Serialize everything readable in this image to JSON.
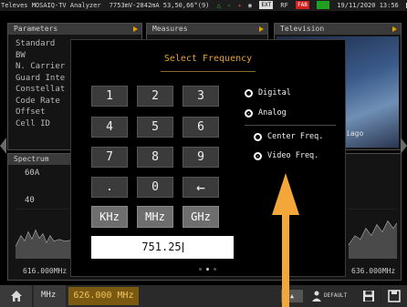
{
  "status_bar": {
    "device": "Televes MOSAIQ-TV Analyzer",
    "readout": "7753mV-2842mA 53,50,66°(9)",
    "badge_ext": "EXT",
    "rf_label": "RF",
    "badge_fab": "FAB",
    "datetime": "19/11/2020 13:56"
  },
  "panels": {
    "parameters": {
      "title": "Parameters",
      "items": [
        "Standard",
        "BW",
        "N. Carrier",
        "Guard Inte",
        "Constellat",
        "Code Rate",
        "Offset",
        "Cell ID"
      ]
    },
    "measures": {
      "title": "Measures"
    },
    "television": {
      "title": "Television",
      "caption": "iago"
    },
    "spectrum": {
      "title": "Spectrum",
      "scale_top": "60A",
      "scale_mid": "40",
      "freq_left": "616.000MHz",
      "freq_right": "636.000MHz"
    }
  },
  "dialog": {
    "title": "Select Frequency",
    "keys": [
      "1",
      "2",
      "3",
      "4",
      "5",
      "6",
      "7",
      "8",
      "9",
      ".",
      "0",
      "←"
    ],
    "units": [
      "KHz",
      "MHz",
      "GHz"
    ],
    "input_value": "751.25",
    "options": {
      "digital": "Digital",
      "analog": "Analog",
      "center_freq": "Center Freq.",
      "video_freq": "Video Freq."
    }
  },
  "bottom_bar": {
    "mhz_label": "MHz",
    "freq": "626.000 MHz",
    "default_label": "DEFAULT"
  },
  "colors": {
    "accent": "#e6a336",
    "arrow": "#f3a73a",
    "fab_badge": "#d02020",
    "green_badge": "#20a020"
  }
}
